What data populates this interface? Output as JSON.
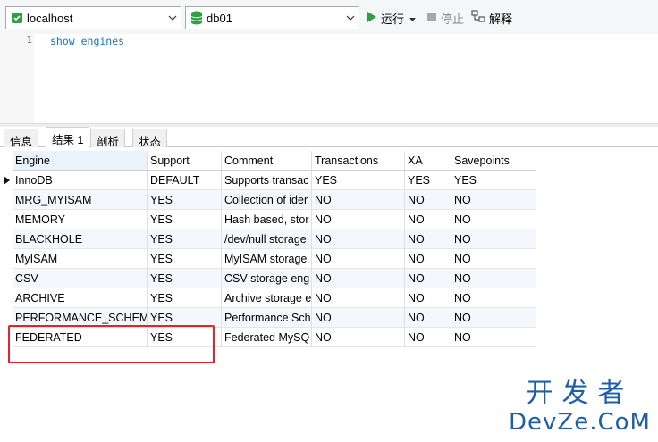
{
  "toolbar": {
    "connection": "localhost",
    "database": "db01",
    "run_label": "运行",
    "stop_label": "停止",
    "explain_label": "解释"
  },
  "editor": {
    "line_number": "1",
    "sql": "show engines"
  },
  "tabs": [
    {
      "label": "信息",
      "active": false
    },
    {
      "label": "结果 1",
      "active": true
    },
    {
      "label": "剖析",
      "active": false
    },
    {
      "label": "状态",
      "active": false
    }
  ],
  "grid": {
    "columns": [
      "Engine",
      "Support",
      "Comment",
      "Transactions",
      "XA",
      "Savepoints"
    ],
    "rows": [
      [
        "InnoDB",
        "DEFAULT",
        "Supports transac",
        "YES",
        "YES",
        "YES"
      ],
      [
        "MRG_MYISAM",
        "YES",
        "Collection of ider",
        "NO",
        "NO",
        "NO"
      ],
      [
        "MEMORY",
        "YES",
        "Hash based, stor",
        "NO",
        "NO",
        "NO"
      ],
      [
        "BLACKHOLE",
        "YES",
        "/dev/null storage",
        "NO",
        "NO",
        "NO"
      ],
      [
        "MyISAM",
        "YES",
        "MyISAM storage",
        "NO",
        "NO",
        "NO"
      ],
      [
        "CSV",
        "YES",
        "CSV storage eng",
        "NO",
        "NO",
        "NO"
      ],
      [
        "ARCHIVE",
        "YES",
        "Archive storage e",
        "NO",
        "NO",
        "NO"
      ],
      [
        "PERFORMANCE_SCHEMA",
        "YES",
        "Performance Sch",
        "NO",
        "NO",
        "NO"
      ],
      [
        "FEDERATED",
        "YES",
        "Federated MySQ",
        "NO",
        "NO",
        "NO"
      ]
    ]
  },
  "watermark": {
    "line1": "开发者",
    "line2": "DevZe.CoM"
  },
  "colors": {
    "highlight": "#e3242b",
    "run_green": "#2ea043",
    "db_green": "#2ea043",
    "sql_blue": "#1a6fc2",
    "watermark": "#1f5fa8"
  }
}
